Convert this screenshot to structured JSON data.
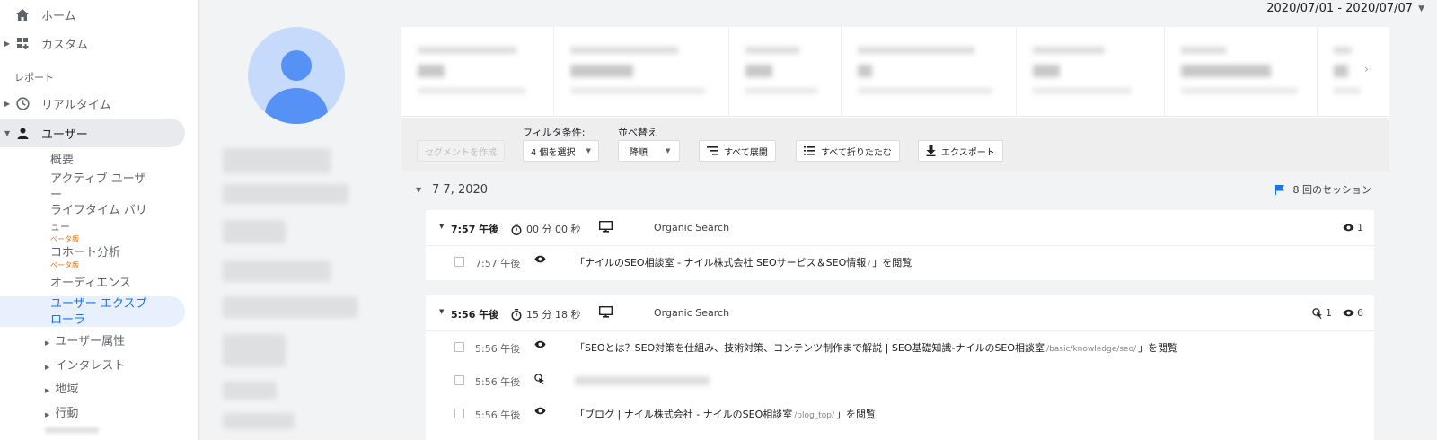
{
  "sidebar": {
    "home_label": "ホーム",
    "custom_label": "カスタム",
    "report_section": "レポート",
    "realtime_label": "リアルタイム",
    "users_label": "ユーザー",
    "sub": {
      "overview": "概要",
      "active_users_1": "アクティブ ユーザ",
      "active_users_2": "ー",
      "ltv_1": "ライフタイム バリ",
      "ltv_2": "ュー",
      "ltv_badge": "ベータ版",
      "cohort": "コホート分析",
      "cohort_badge": "ベータ版",
      "audience": "オーディエンス",
      "explorer_1": "ユーザー エクスプ",
      "explorer_2": "ローラ",
      "demographics": "ユーザー属性",
      "interests": "インタレスト",
      "geo": "地域",
      "behavior": "行動"
    }
  },
  "date_range": "2020/07/01 - 2020/07/07",
  "toolbar": {
    "segment_button": "セグメントを作成",
    "filter_label": "フィルタ条件:",
    "filter_value": "4 個を選択",
    "sort_label": "並べ替え",
    "sort_value": "降順",
    "expand_all": "すべて展開",
    "collapse_all": "すべて折りたたむ",
    "export": "エクスポート"
  },
  "day": {
    "date": "7 7, 2020",
    "sessions": "8 回のセッション"
  },
  "sessions": [
    {
      "time": "7:57 午後",
      "duration": "00 分 00 秒",
      "source": "Organic Search",
      "views": "1",
      "hits": [
        {
          "time": "7:57 午後",
          "text_pre": "「ナイルのSEO相談室 - ナイル株式会社 SEOサービス＆SEO情報",
          "path": "/",
          "text_post": "」を閲覧"
        }
      ]
    },
    {
      "time": "5:56 午後",
      "duration": "15 分 18 秒",
      "source": "Organic Search",
      "goals": "1",
      "views": "6",
      "hits": [
        {
          "time": "5:56 午後",
          "text_pre": "「SEOとは？SEO対策を仕組み、技術対策、コンテンツ制作まで解説 | SEO基礎知識-ナイルのSEO相談室",
          "path": "/basic/knowledge/seo/",
          "text_post": "」を閲覧"
        },
        {
          "time": "5:56 午後"
        },
        {
          "time": "5:56 午後",
          "text_pre": "「ブログ | ナイル株式会社 - ナイルのSEO相談室",
          "path": "/blog_top/",
          "text_post": "」を閲覧"
        }
      ]
    }
  ],
  "colors": {
    "accent": "#1a73e8",
    "beta": "#e8710a",
    "active_nav": "#e8f0fe"
  }
}
